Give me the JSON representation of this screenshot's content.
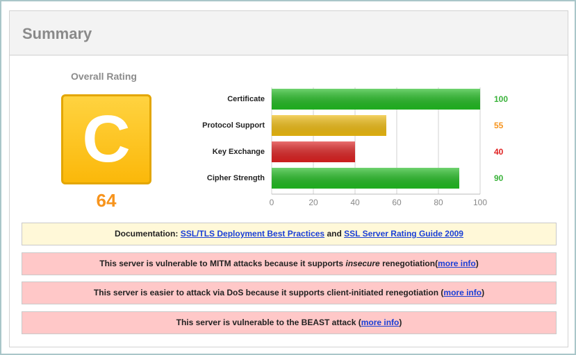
{
  "summary": {
    "title": "Summary"
  },
  "rating": {
    "label": "Overall Rating",
    "grade": "C",
    "score": "64",
    "grade_color": "#fbb80a",
    "score_color": "#f7941d"
  },
  "chart_data": {
    "type": "bar",
    "orientation": "horizontal",
    "categories": [
      "Certificate",
      "Protocol Support",
      "Key Exchange",
      "Cipher Strength"
    ],
    "values": [
      100,
      55,
      40,
      90
    ],
    "value_labels": [
      "100",
      "55",
      "40",
      "90"
    ],
    "colors": [
      "#22bb22",
      "#eebb11",
      "#dd2222",
      "#22bb22"
    ],
    "label_colors": [
      "#3bb33b",
      "#f7941d",
      "#e02020",
      "#3bb33b"
    ],
    "xlim": [
      0,
      100
    ],
    "xticks": [
      "0",
      "20",
      "40",
      "60",
      "80",
      "100"
    ],
    "grid": true
  },
  "documentation": {
    "prefix": "Documentation:",
    "link1": "SSL/TLS Deployment Best Practices",
    "middle": "and",
    "link2": "SSL Server Rating Guide 2009"
  },
  "warnings": [
    {
      "before": "This server is vulnerable to MITM attacks because it supports",
      "emphasis": "insecure",
      "after": "renegotiation",
      "link": "more info"
    },
    {
      "text": "This server is easier to attack via DoS because it supports client-initiated renegotiation",
      "link": "more info"
    },
    {
      "text": "This server is vulnerable to the BEAST attack",
      "link": "more info"
    }
  ]
}
